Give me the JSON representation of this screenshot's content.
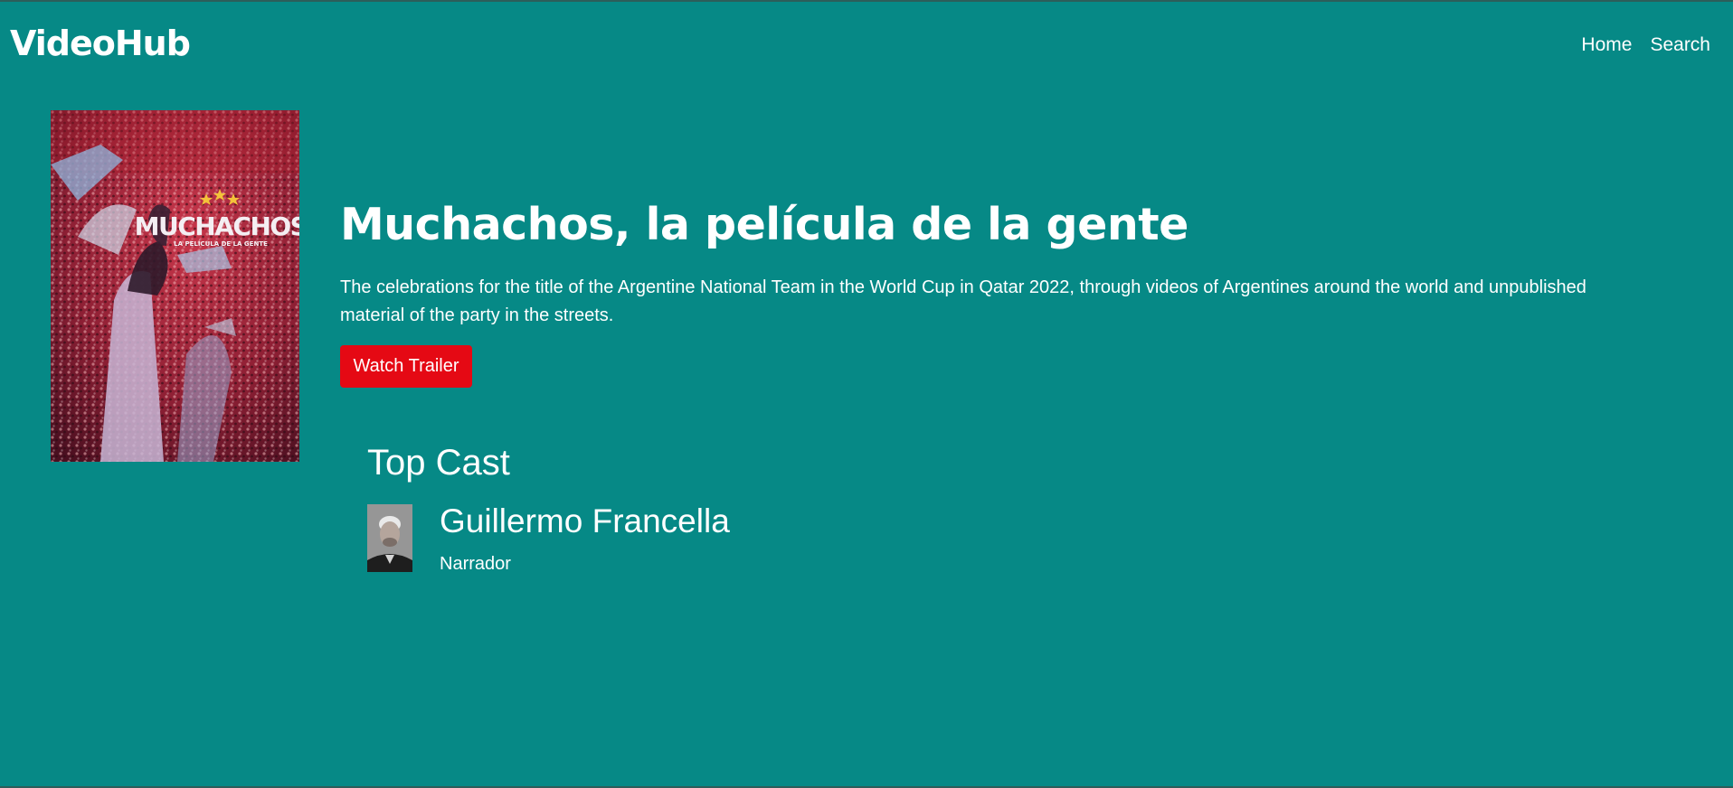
{
  "navbar": {
    "brand": "VideoHub",
    "links": [
      "Home",
      "Search"
    ]
  },
  "movie": {
    "poster": {
      "title_text": "MUCHACHOS",
      "subtitle_text": "LA PELÍCULA DE LA GENTE"
    },
    "title": "Muchachos, la película de la gente",
    "overview": "The celebrations for the title of the Argentine National Team in the World Cup in Qatar 2022, through videos of Argentines around the world and unpublished material of the party in the streets.",
    "trailer_button": "Watch Trailer"
  },
  "cast": {
    "heading": "Top Cast",
    "members": [
      {
        "name": "Guillermo Francella",
        "role": "Narrador"
      }
    ]
  },
  "colors": {
    "background": "#068986",
    "button": "#e50914",
    "text": "#ffffff"
  }
}
